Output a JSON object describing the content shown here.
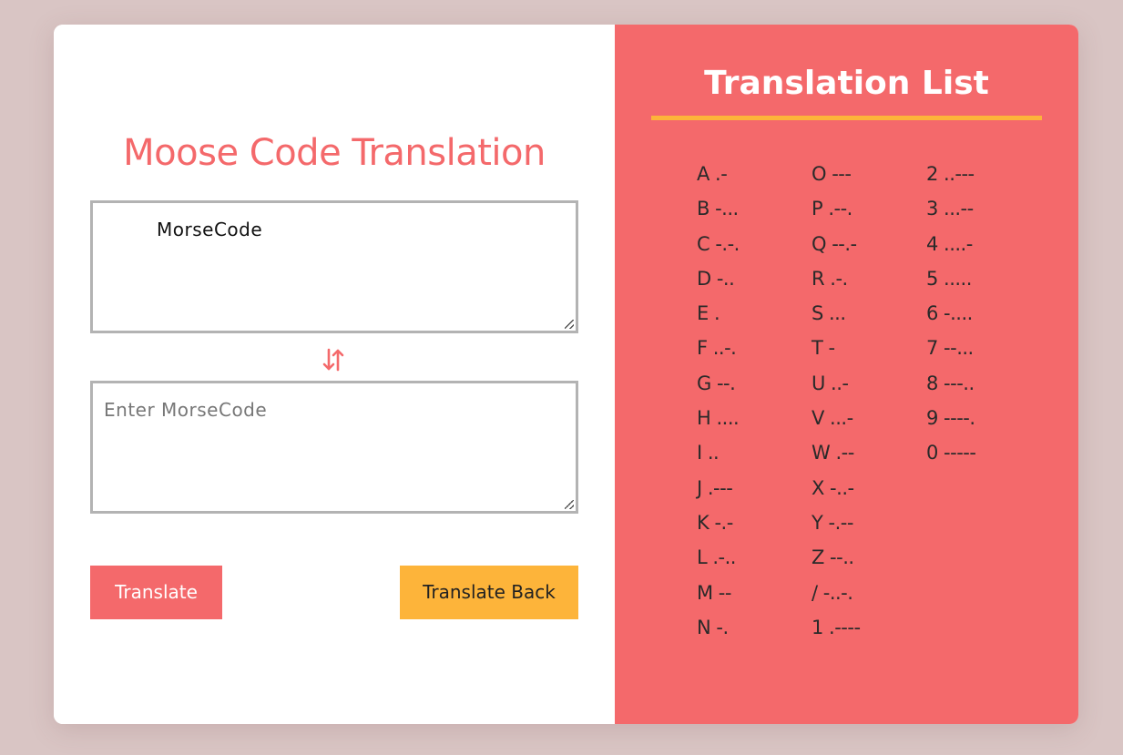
{
  "translator": {
    "title": "Moose Code Translation",
    "input_value": "MorseCode",
    "output_placeholder": "Enter MorseCode",
    "swap_icon": "swap-vertical-icon",
    "translate_label": "Translate",
    "translate_back_label": "Translate Back"
  },
  "list": {
    "title": "Translation List",
    "columns": [
      [
        "A .-",
        "B -...",
        "C -.-.",
        "D -..",
        "E .",
        "F ..-.",
        "G --.",
        "H ....",
        "I ..",
        "J .---",
        "K -.-",
        "L .-..",
        "M --",
        "N -."
      ],
      [
        "O ---",
        "P .--.",
        "Q --.-",
        "R .-.",
        "S ...",
        "T -",
        "U ..-",
        "V ...-",
        "W .--",
        "X -..-",
        "Y -.--",
        "Z --..",
        "/ -..-.",
        "1 .----"
      ],
      [
        "2 ..---",
        "3 ...--",
        "4 ....-",
        "5 .....",
        "6 -....",
        "7 --...",
        "8 ---..",
        "9 ----.",
        "0 -----"
      ]
    ]
  },
  "colors": {
    "background": "#d9c5c4",
    "accent": "#f4696b",
    "secondary": "#fdb43a"
  }
}
